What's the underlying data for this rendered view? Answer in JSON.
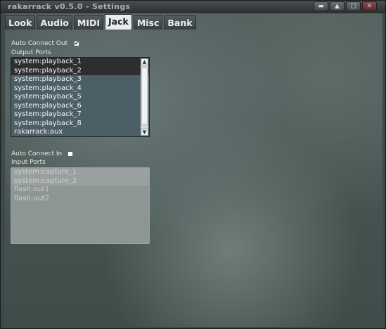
{
  "window": {
    "title": "rakarrack   v0.5.0 - Settings",
    "buttons": {
      "minimize": "▬",
      "shade": "▲",
      "maximize": "▢",
      "close": "✕"
    }
  },
  "tabs": [
    {
      "label": "Look"
    },
    {
      "label": "Audio"
    },
    {
      "label": "MIDI"
    },
    {
      "label": "Jack"
    },
    {
      "label": "Misc"
    },
    {
      "label": "Bank"
    }
  ],
  "jack": {
    "auto_connect_out": {
      "label": "Auto Connect Out",
      "checked": true,
      "mark": "✔"
    },
    "output_ports": {
      "label": "Output Ports",
      "items": [
        "system:playback_1",
        "system:playback_2",
        "system:playback_3",
        "system:playback_4",
        "system:playback_5",
        "system:playback_6",
        "system:playback_7",
        "system:playback_8",
        "rakarrack:aux"
      ]
    },
    "auto_connect_in": {
      "label": "Auto Connect In",
      "checked": false,
      "mark": ""
    },
    "input_ports": {
      "label": "Input Ports",
      "items": [
        "system:capture_1",
        "system:capture_2",
        "flash:out1",
        "flash:out2"
      ]
    }
  },
  "scroll": {
    "up": "▲",
    "down": "▼"
  }
}
